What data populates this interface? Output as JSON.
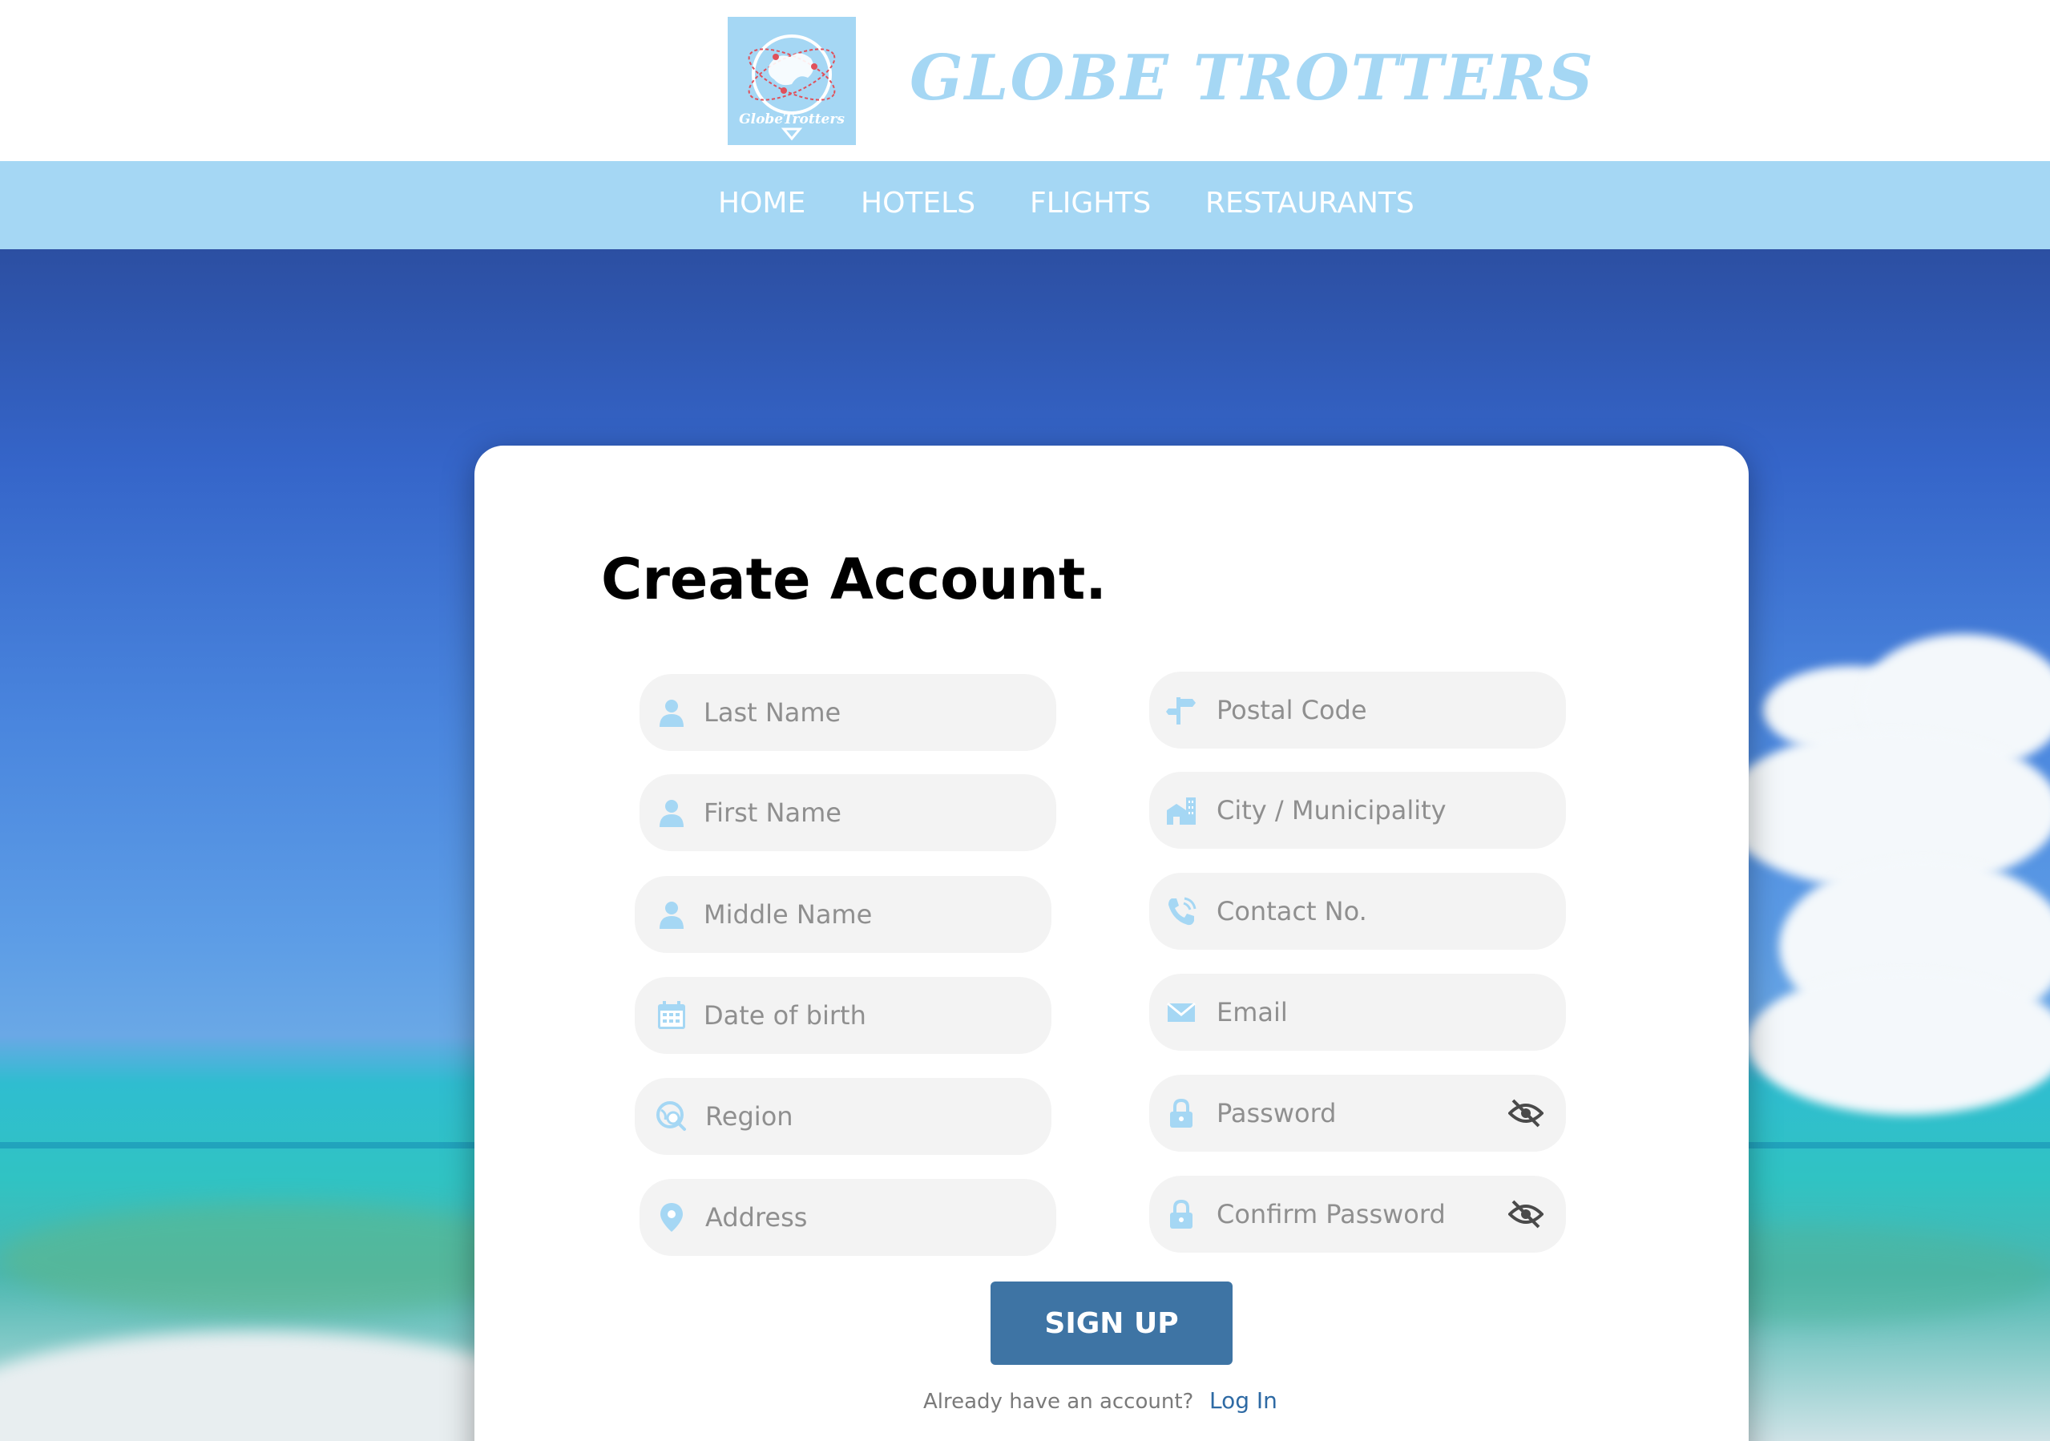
{
  "header": {
    "logo_text": "GlobeTrotters",
    "brand": "GLOBE TROTTERS"
  },
  "nav": {
    "items": [
      {
        "label": "HOME"
      },
      {
        "label": "HOTELS"
      },
      {
        "label": "FLIGHTS"
      },
      {
        "label": "RESTAURANTS"
      }
    ]
  },
  "form": {
    "title": "Create Account.",
    "fields": {
      "last_name": {
        "placeholder": "Last Name",
        "icon": "user-icon"
      },
      "first_name": {
        "placeholder": "First Name",
        "icon": "user-icon"
      },
      "middle_name": {
        "placeholder": "Middle Name",
        "icon": "user-icon"
      },
      "dob": {
        "placeholder": "Date of birth",
        "icon": "calendar-icon"
      },
      "region": {
        "placeholder": "Region",
        "icon": "globe-search-icon"
      },
      "address": {
        "placeholder": "Address",
        "icon": "map-pin-icon"
      },
      "postal": {
        "placeholder": "Postal Code",
        "icon": "signpost-icon"
      },
      "city": {
        "placeholder": "City / Municipality",
        "icon": "city-building-icon"
      },
      "contact": {
        "placeholder": "Contact No.",
        "icon": "phone-icon"
      },
      "email": {
        "placeholder": "Email",
        "icon": "envelope-icon"
      },
      "password": {
        "placeholder": "Password",
        "icon": "lock-icon"
      },
      "confirm_password": {
        "placeholder": "Confirm Password",
        "icon": "lock-icon"
      }
    },
    "signup_label": "SIGN UP",
    "login_prompt": "Already have an account?",
    "login_link": "Log In"
  },
  "colors": {
    "brand_light_blue": "#a5d7f4",
    "button_blue": "#3e74a4",
    "link_blue": "#2e6aa4",
    "field_bg": "#f3f3f3"
  }
}
